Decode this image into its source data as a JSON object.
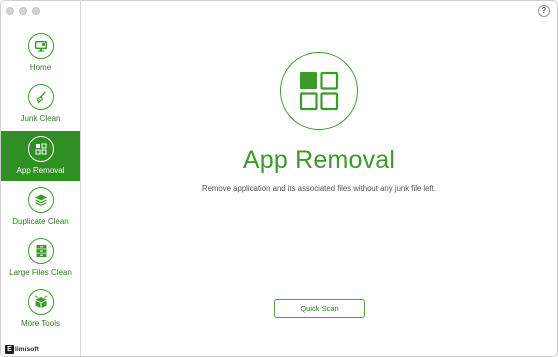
{
  "window": {
    "help_label": "?"
  },
  "sidebar": {
    "items": [
      {
        "label": "Home",
        "icon": "monitor-icon"
      },
      {
        "label": "Junk Clean",
        "icon": "broom-icon"
      },
      {
        "label": "App Removal",
        "icon": "grid-icon",
        "active": true
      },
      {
        "label": "Duplicate Clean",
        "icon": "layers-icon"
      },
      {
        "label": "Large Files Clean",
        "icon": "drawers-icon"
      },
      {
        "label": "More Tools",
        "icon": "box-icon"
      }
    ],
    "logo_text": "limisoft",
    "logo_mark": "E"
  },
  "main": {
    "hero_icon": "app-grid-icon",
    "title": "App Removal",
    "subtitle": "Remove application and its associated files without any junk file left.",
    "scan_button": "Quick Scan"
  },
  "colors": {
    "accent": "#3b9a2a",
    "active_bg": "#2f8f22"
  }
}
